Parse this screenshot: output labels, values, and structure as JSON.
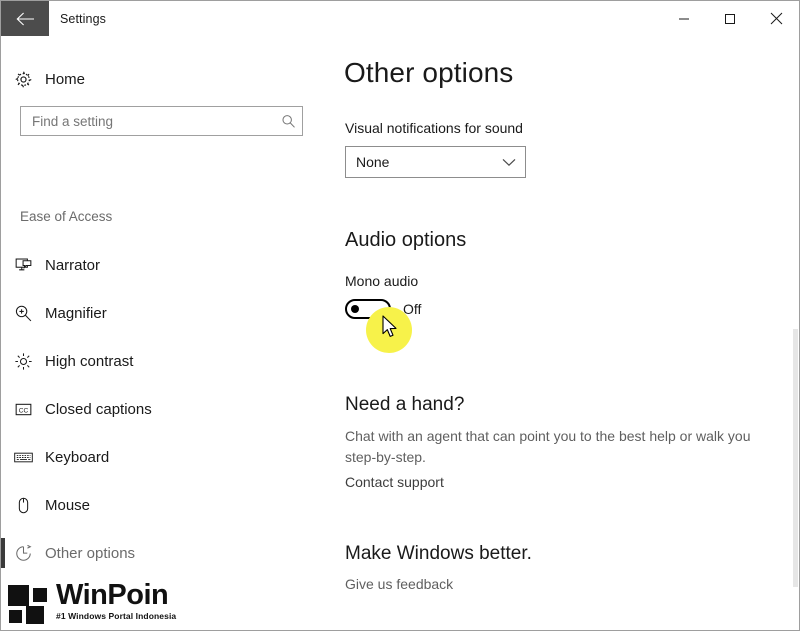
{
  "window": {
    "title": "Settings",
    "back_icon": "back-arrow-icon",
    "minimize_label": "—",
    "maximize_label": "□",
    "close_label": "✕"
  },
  "sidebar": {
    "home": {
      "label": "Home",
      "icon": "gear-icon"
    },
    "search": {
      "value": "",
      "placeholder": "Find a setting",
      "icon": "search-icon"
    },
    "section_label": "Ease of Access",
    "items": [
      {
        "label": "Narrator",
        "icon": "narrator-icon",
        "selected": false
      },
      {
        "label": "Magnifier",
        "icon": "magnifier-icon",
        "selected": false
      },
      {
        "label": "High contrast",
        "icon": "high-contrast-icon",
        "selected": false
      },
      {
        "label": "Closed captions",
        "icon": "closed-captions-icon",
        "selected": false
      },
      {
        "label": "Keyboard",
        "icon": "keyboard-icon",
        "selected": false
      },
      {
        "label": "Mouse",
        "icon": "mouse-icon",
        "selected": false
      },
      {
        "label": "Other options",
        "icon": "other-options-icon",
        "selected": true
      }
    ]
  },
  "main": {
    "page_title": "Other options",
    "visual_notifications": {
      "label": "Visual notifications for sound",
      "selected": "None",
      "chevron_icon": "chevron-down-icon"
    },
    "audio_options": {
      "heading": "Audio options",
      "mono_audio": {
        "label": "Mono audio",
        "state": "Off",
        "checked": false
      }
    },
    "need_a_hand": {
      "heading": "Need a hand?",
      "body": "Chat with an agent that can point you to the best help or walk you step-by-step.",
      "link": "Contact support"
    },
    "make_better": {
      "heading": "Make Windows better.",
      "link": "Give us feedback"
    }
  },
  "watermark": {
    "name": "WinPoin",
    "tagline": "#1 Windows Portal Indonesia"
  },
  "colors": {
    "accent_selected_bar": "#3a3a3a",
    "back_button_bg": "#4c4c4c",
    "click_highlight": "#f7f24a",
    "muted_text": "#6b6b6b"
  }
}
